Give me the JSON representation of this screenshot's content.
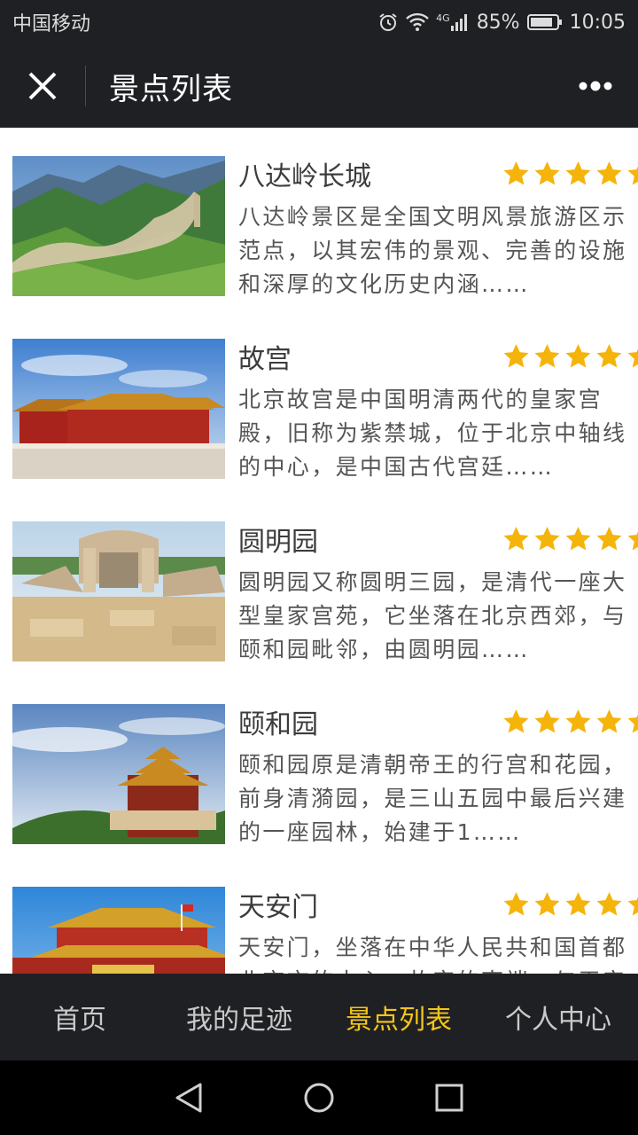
{
  "status_bar": {
    "carrier": "中国移动",
    "network": "4G",
    "battery": "85%",
    "time": "10:05",
    "icons": [
      "alarm-icon",
      "wifi-icon",
      "signal-icon",
      "battery-icon"
    ]
  },
  "nav": {
    "title": "景点列表",
    "close_icon": "close-icon",
    "more_icon": "more-icon"
  },
  "items": [
    {
      "title": "八达岭长城",
      "rating": 5,
      "description": "八达岭景区是全国文明风景旅游区示范点，以其宏伟的景观、完善的设施和深厚的文化历史内涵……",
      "thumb": "great-wall-photo"
    },
    {
      "title": "故宫",
      "rating": 5,
      "description": "北京故宫是中国明清两代的皇家宫殿，旧称为紫禁城，位于北京中轴线的中心，是中国古代宫廷……",
      "thumb": "forbidden-city-photo"
    },
    {
      "title": "圆明园",
      "rating": 5,
      "description": "圆明园又称圆明三园，是清代一座大型皇家宫苑，它坐落在北京西郊，与颐和园毗邻，由圆明园……",
      "thumb": "yuanmingyuan-photo"
    },
    {
      "title": "颐和园",
      "rating": 5,
      "description": "颐和园原是清朝帝王的行宫和花园，前身清漪园，是三山五园中最后兴建的一座园林，始建于1……",
      "thumb": "summer-palace-photo"
    },
    {
      "title": "天安门",
      "rating": 5,
      "description": "天安门，坐落在中华人民共和国首都北京市的中心，故宫的南端，与天安",
      "thumb": "tiananmen-photo"
    }
  ],
  "tabs": [
    {
      "label": "首页",
      "active": false
    },
    {
      "label": "我的足迹",
      "active": false
    },
    {
      "label": "景点列表",
      "active": true
    },
    {
      "label": "个人中心",
      "active": false
    }
  ],
  "colors": {
    "bar_bg": "#1f2023",
    "accent": "#f5c518",
    "star": "#f5b40a"
  }
}
